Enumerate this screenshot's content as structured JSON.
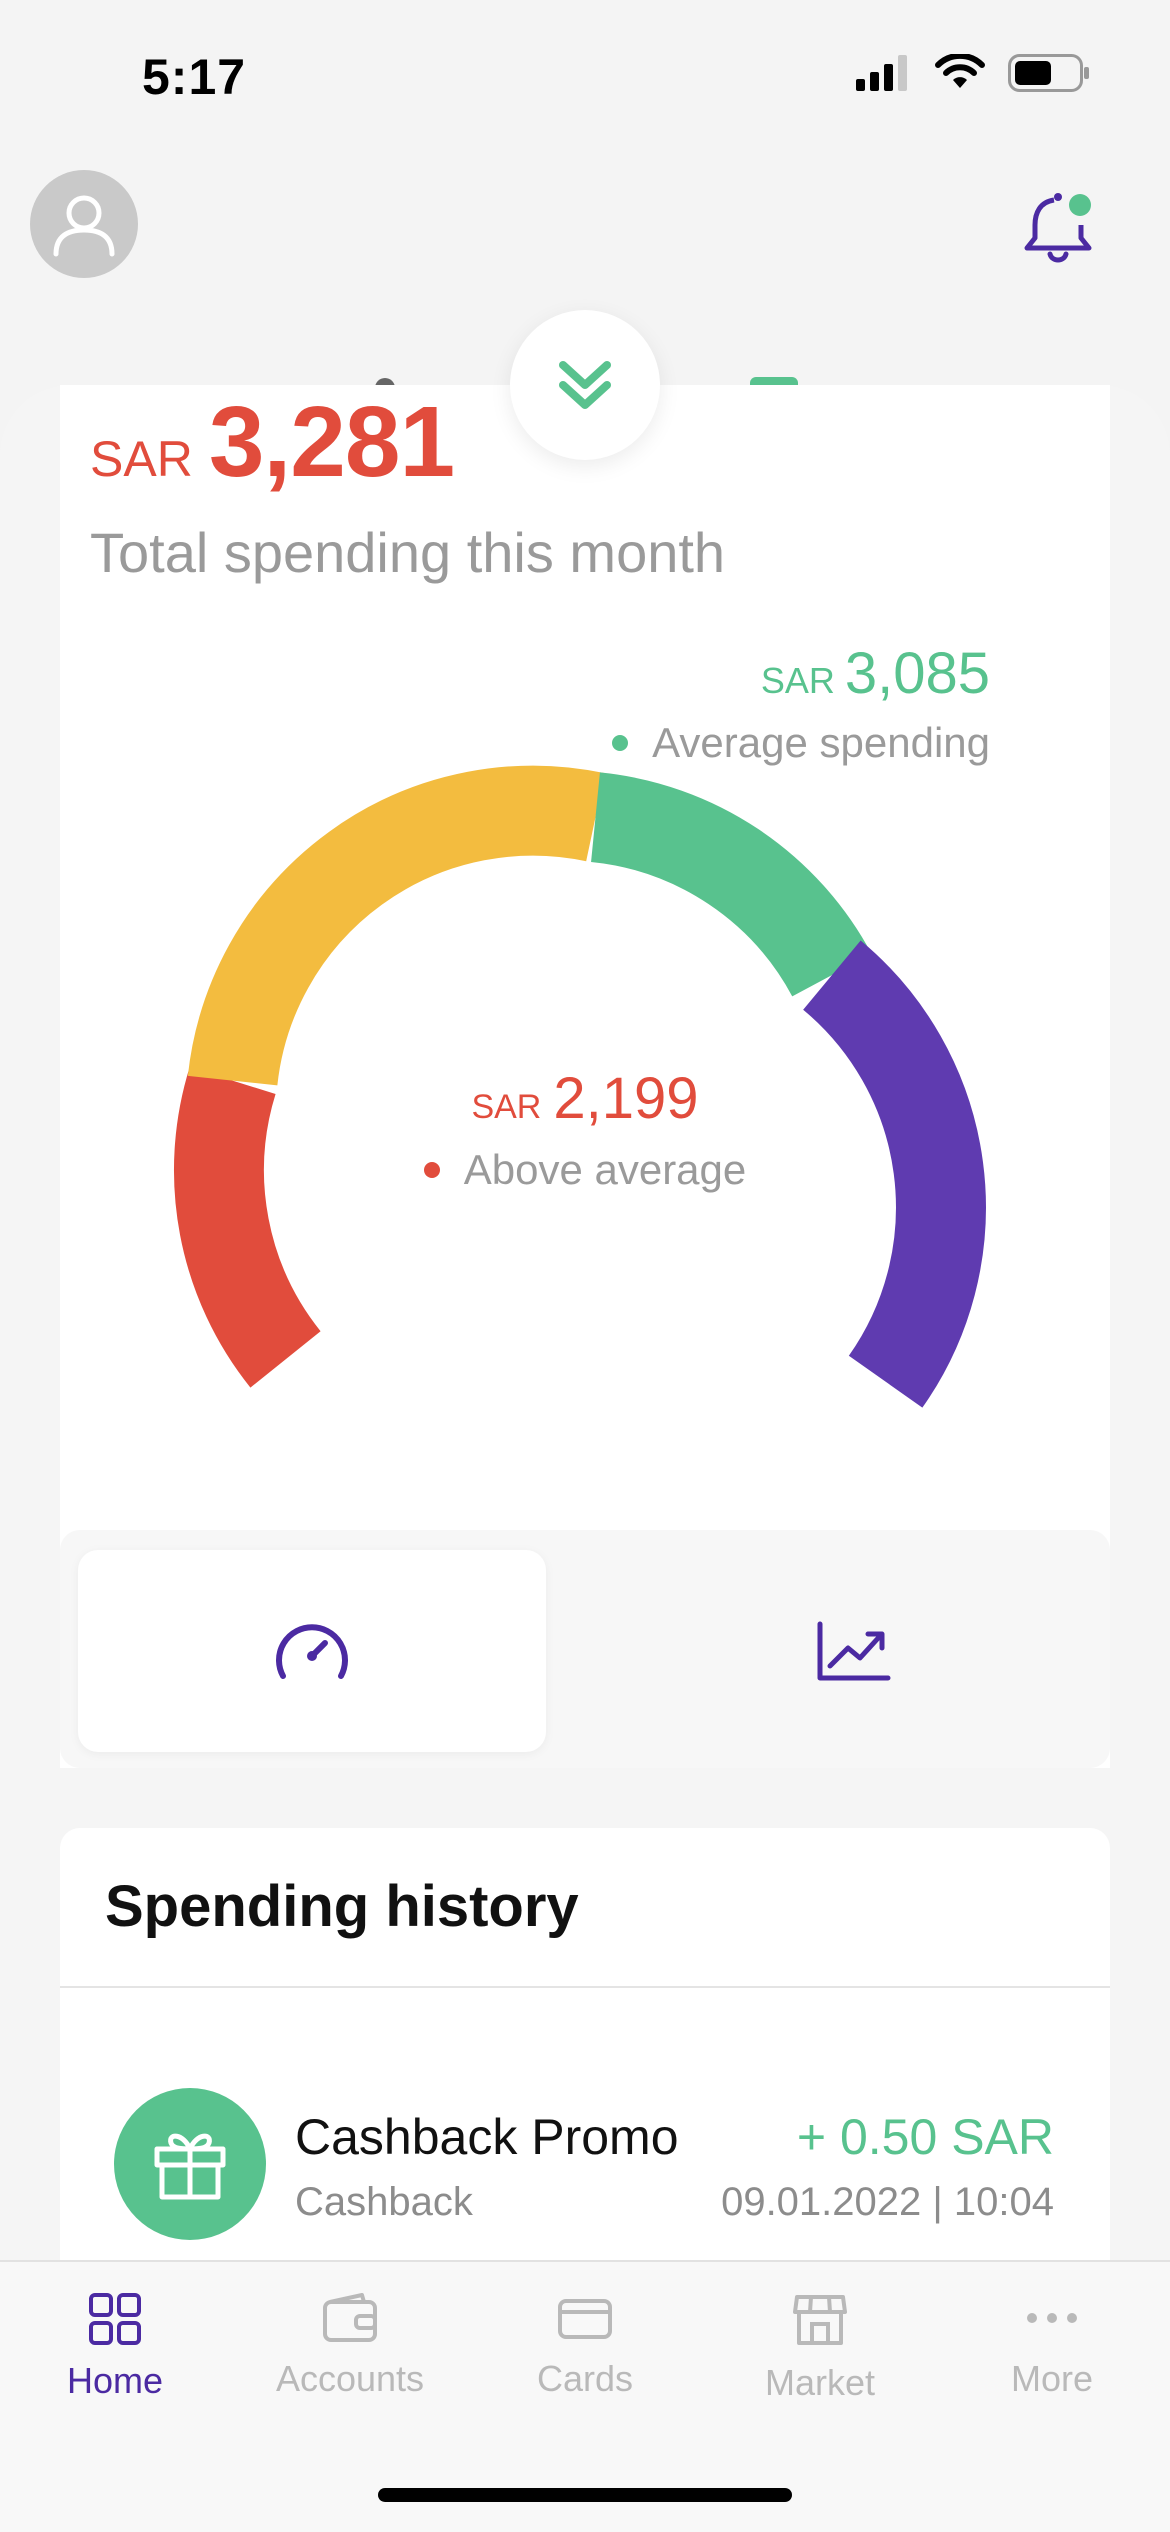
{
  "status_bar": {
    "time": "5:17"
  },
  "colors": {
    "red": "#e14c3c",
    "yellow": "#f3bc3f",
    "green": "#58c28e",
    "purple": "#5f3bb0",
    "brand": "#4b2aa2"
  },
  "spending": {
    "currency": "SAR",
    "total_amount": "3,281",
    "total_label": "Total spending this month",
    "average_amount": "3,085",
    "average_label": "Average spending",
    "difference_amount": "2,199",
    "difference_label": "Above average"
  },
  "gauge_segments": [
    {
      "name": "red",
      "color": "#e14c3c"
    },
    {
      "name": "yellow",
      "color": "#f3bc3f"
    },
    {
      "name": "green",
      "color": "#58c28e"
    },
    {
      "name": "purple",
      "color": "#5f3bb0"
    }
  ],
  "view_toggle": {
    "active": "gauge-icon",
    "options": [
      "gauge-icon",
      "trend-chart-icon"
    ]
  },
  "history": {
    "title": "Spending history",
    "transactions": [
      {
        "name": "Cashback Promo",
        "category": "Cashback",
        "amount": "+ 0.50 SAR",
        "datetime": "09.01.2022 | 10:04",
        "icon": "gift-icon"
      }
    ]
  },
  "tabs": [
    {
      "label": "Home",
      "icon": "grid-icon",
      "active": true
    },
    {
      "label": "Accounts",
      "icon": "wallet-icon",
      "active": false
    },
    {
      "label": "Cards",
      "icon": "card-icon",
      "active": false
    },
    {
      "label": "Market",
      "icon": "store-icon",
      "active": false
    },
    {
      "label": "More",
      "icon": "dots-icon",
      "active": false
    }
  ]
}
